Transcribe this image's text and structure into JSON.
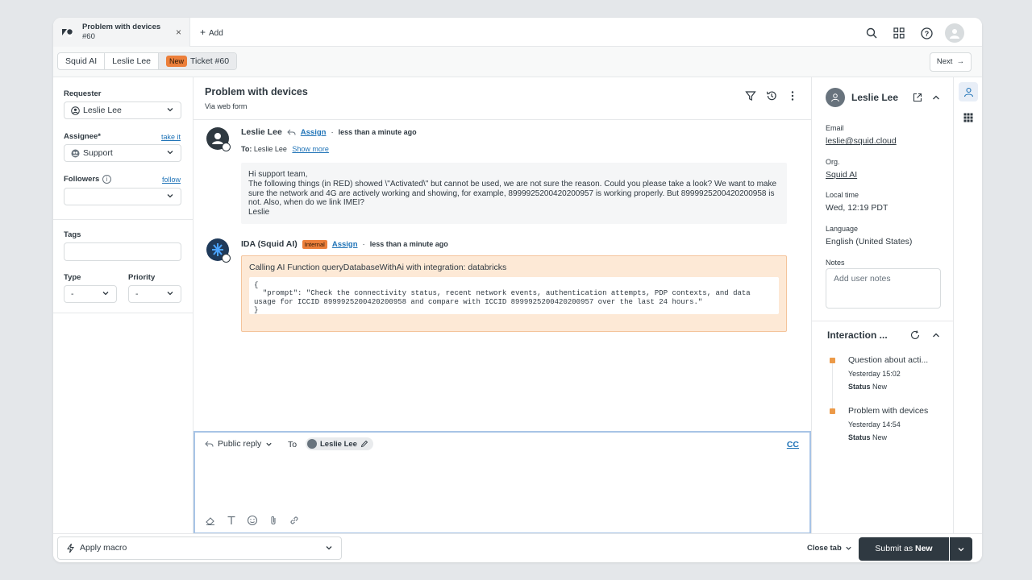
{
  "tab": {
    "title": "Problem with devices",
    "subtitle": "#60",
    "close": "×",
    "add_label": "Add"
  },
  "breadcrumbs": {
    "org": "Squid AI",
    "user": "Leslie Lee",
    "status_badge": "New",
    "ticket": "Ticket #60"
  },
  "next_label": "Next",
  "left": {
    "requester_label": "Requester",
    "requester_value": "Leslie Lee",
    "assignee_label": "Assignee*",
    "take_it": "take it",
    "assignee_value": "Support",
    "followers_label": "Followers",
    "follow": "follow",
    "tags_label": "Tags",
    "type_label": "Type",
    "type_value": "-",
    "priority_label": "Priority",
    "priority_value": "-"
  },
  "conversation": {
    "title": "Problem with devices",
    "via": "Via web form",
    "messages": [
      {
        "author": "Leslie Lee",
        "assign": "Assign",
        "time": "less than a minute ago",
        "to_label": "To:",
        "to_value": "Leslie Lee",
        "show_more": "Show more",
        "lines": [
          "Hi support team,",
          "The following things (in RED) showed \\\"Activated\\\" but cannot be used, we are not sure the reason. Could you please take a look? We want to make sure the network and 4G are actively working and showing, for example, 8999925200420200957  is working properly. But 8999925200420200958 is not. Also, when do we link IMEI?",
          "Leslie"
        ]
      },
      {
        "author": "IDA (Squid AI)",
        "badge": "Internal",
        "assign": "Assign",
        "time": "less than a minute ago",
        "title": "Calling AI Function queryDatabaseWithAi with integration: databricks",
        "code": "{\n  \"prompt\": \"Check the connectivity status, recent network events, authentication attempts, PDP contexts, and data usage for ICCID 8999925200420200958 and compare with ICCID 8999925200420200957 over the last 24 hours.\"\n}"
      }
    ]
  },
  "composer": {
    "reply_type": "Public reply",
    "to_label": "To",
    "recipient": "Leslie Lee",
    "cc": "CC"
  },
  "user_panel": {
    "name": "Leslie Lee",
    "email_label": "Email",
    "email": "leslie@squid.cloud",
    "org_label": "Org.",
    "org": "Squid AI",
    "local_time_label": "Local time",
    "local_time": "Wed, 12:19 PDT",
    "language_label": "Language",
    "language": "English (United States)",
    "notes_label": "Notes",
    "notes_placeholder": "Add user notes"
  },
  "interactions": {
    "title": "Interaction ...",
    "items": [
      {
        "title": "Question about acti...",
        "time": "Yesterday 15:02",
        "status_label": "Status",
        "status": "New"
      },
      {
        "title": "Problem with devices",
        "time": "Yesterday 14:54",
        "status_label": "Status",
        "status": "New"
      }
    ]
  },
  "bottom": {
    "macro": "Apply macro",
    "close_tab": "Close tab",
    "submit_prefix": "Submit as",
    "submit_status": "New"
  },
  "colors": {
    "accent": "#1f73b7",
    "dark": "#2f3941",
    "badge_orange": "#ec7f3a",
    "internal_bg": "#fde9d6"
  }
}
